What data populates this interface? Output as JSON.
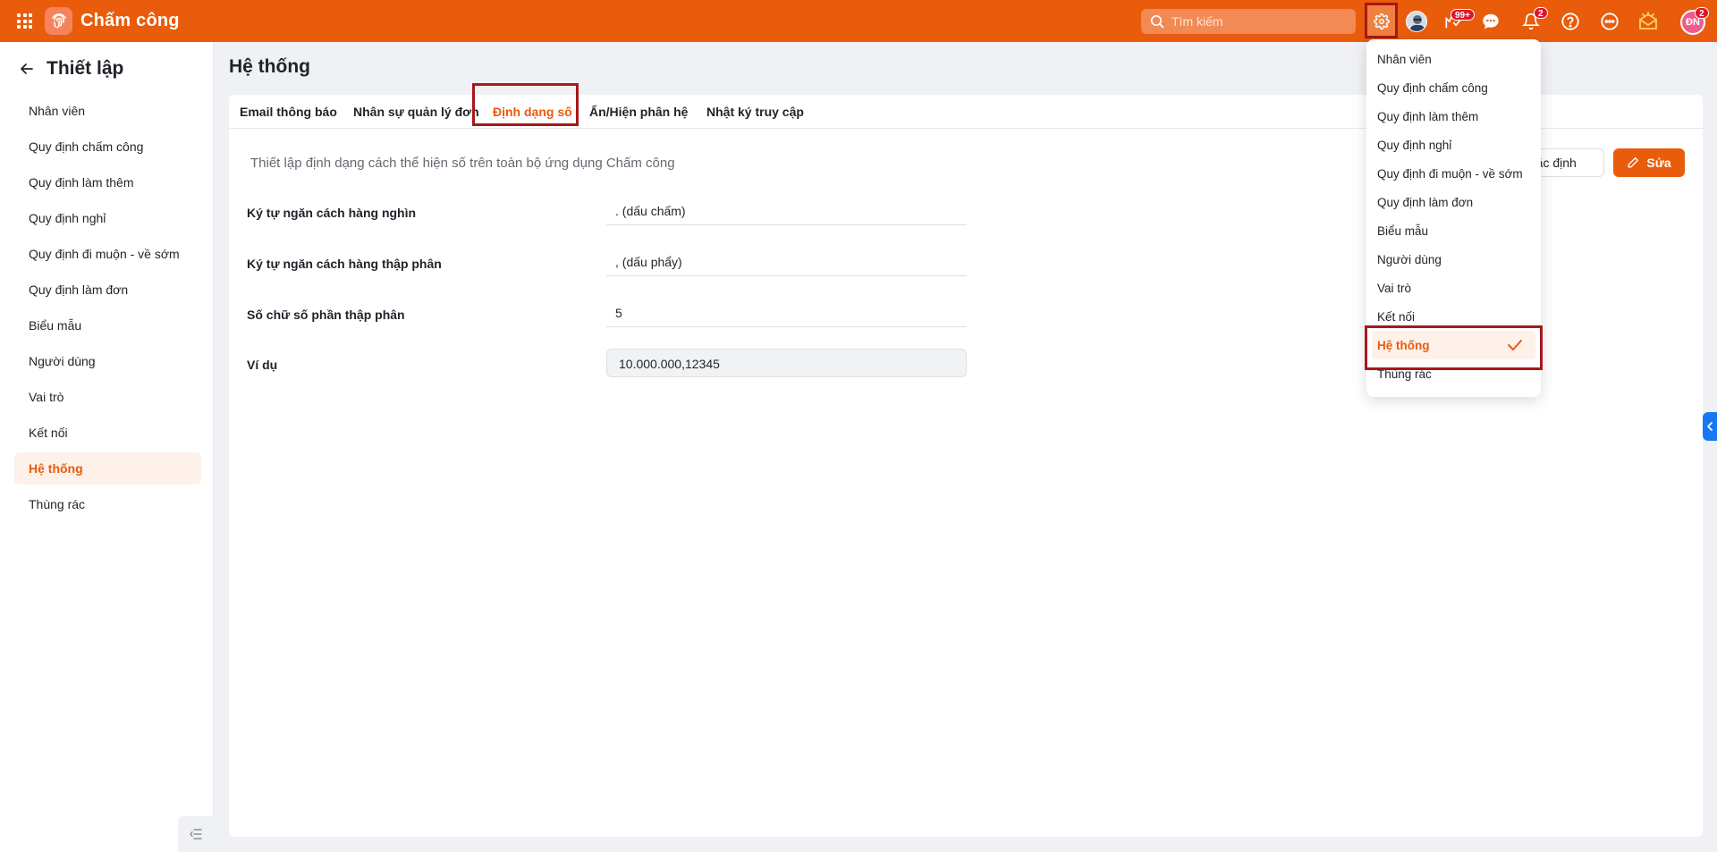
{
  "app": {
    "title": "Chấm công"
  },
  "header": {
    "search_placeholder": "Tìm kiếm",
    "notif_badge_1": "99+",
    "notif_badge_2": "2",
    "avatar_initials": "ĐN",
    "avatar_badge": "2"
  },
  "sidebar": {
    "title": "Thiết lập",
    "items": [
      {
        "label": "Nhân viên"
      },
      {
        "label": "Quy định chấm công"
      },
      {
        "label": "Quy định làm thêm"
      },
      {
        "label": "Quy định nghỉ"
      },
      {
        "label": "Quy định đi muộn - về sớm"
      },
      {
        "label": "Quy định làm đơn"
      },
      {
        "label": "Biểu mẫu"
      },
      {
        "label": "Người dùng"
      },
      {
        "label": "Vai trò"
      },
      {
        "label": "Kết nối"
      },
      {
        "label": "Hệ thống"
      },
      {
        "label": "Thùng rác"
      }
    ],
    "active_index": 10
  },
  "main": {
    "title": "Hệ thống",
    "tabs": [
      {
        "label": "Email thông báo"
      },
      {
        "label": "Nhân sự quản lý đơn"
      },
      {
        "label": "Định dạng số"
      },
      {
        "label": "Ẩn/Hiện phân hệ"
      },
      {
        "label": "Nhật ký truy cập"
      }
    ],
    "active_tab": 2,
    "description": "Thiết lập định dạng cách thể hiện số trên toàn bộ ứng dụng Chấm công",
    "buttons": {
      "default_label": "mặc định",
      "edit_label": "Sửa"
    },
    "fields": [
      {
        "label": "Ký tự ngăn cách hàng nghìn",
        "value": ". (dấu chấm)"
      },
      {
        "label": "Ký tự ngăn cách hàng thập phân",
        "value": ", (dấu phẩy)"
      },
      {
        "label": "Số chữ số phần thập phân",
        "value": "5"
      },
      {
        "label": "Ví dụ",
        "value": "10.000.000,12345"
      }
    ]
  },
  "settings_menu": {
    "items": [
      {
        "label": "Nhân viên"
      },
      {
        "label": "Quy định chấm công"
      },
      {
        "label": "Quy định làm thêm"
      },
      {
        "label": "Quy định nghỉ"
      },
      {
        "label": "Quy định đi muộn - về sớm"
      },
      {
        "label": "Quy định làm đơn"
      },
      {
        "label": "Biểu mẫu"
      },
      {
        "label": "Người dùng"
      },
      {
        "label": "Vai trò"
      },
      {
        "label": "Kết nối"
      },
      {
        "label": "Hệ thống"
      },
      {
        "label": "Thùng rác"
      }
    ],
    "selected_index": 10
  },
  "colors": {
    "brand": "#e95c0c",
    "highlight_box": "#a8171b",
    "active_bg": "#fdf1e9"
  }
}
